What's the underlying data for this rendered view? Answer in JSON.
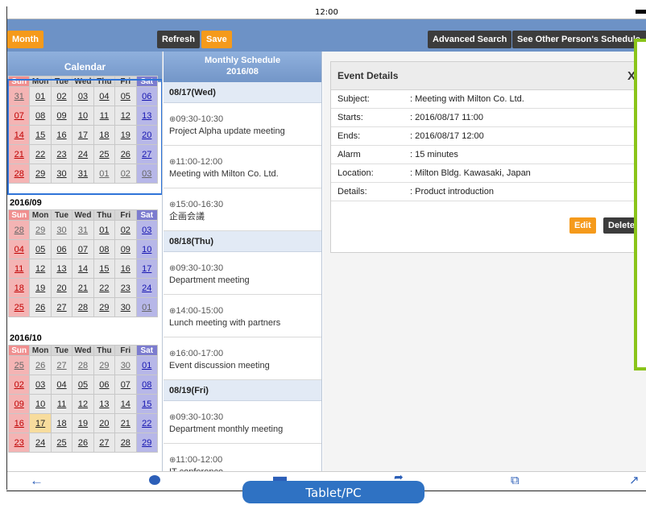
{
  "status_bar": {
    "time": "12:00"
  },
  "toolbar": {
    "month_label": "Month",
    "refresh_label": "Refresh",
    "save_label": "Save",
    "advanced_search_label": "Advanced Search",
    "see_other_label": "See Other Person's Schedule"
  },
  "calendar": {
    "header": "Calendar",
    "dow": [
      "Sun",
      "Mon",
      "Tue",
      "Wed",
      "Thu",
      "Fri",
      "Sat"
    ],
    "months": [
      {
        "title": "",
        "weeks": [
          [
            "31",
            "01",
            "02",
            "03",
            "04",
            "05",
            "06"
          ],
          [
            "07",
            "08",
            "09",
            "10",
            "11",
            "12",
            "13"
          ],
          [
            "14",
            "15",
            "16",
            "17",
            "18",
            "19",
            "20"
          ],
          [
            "21",
            "22",
            "23",
            "24",
            "25",
            "26",
            "27"
          ],
          [
            "28",
            "29",
            "30",
            "31",
            "01",
            "02",
            "03"
          ]
        ]
      },
      {
        "title": "2016/09",
        "weeks": [
          [
            "28",
            "29",
            "30",
            "31",
            "01",
            "02",
            "03"
          ],
          [
            "04",
            "05",
            "06",
            "07",
            "08",
            "09",
            "10"
          ],
          [
            "11",
            "12",
            "13",
            "14",
            "15",
            "16",
            "17"
          ],
          [
            "18",
            "19",
            "20",
            "21",
            "22",
            "23",
            "24"
          ],
          [
            "25",
            "26",
            "27",
            "28",
            "29",
            "30",
            "01"
          ]
        ]
      },
      {
        "title": "2016/10",
        "weeks": [
          [
            "25",
            "26",
            "27",
            "28",
            "29",
            "30",
            "01"
          ],
          [
            "02",
            "03",
            "04",
            "05",
            "06",
            "07",
            "08"
          ],
          [
            "09",
            "10",
            "11",
            "12",
            "13",
            "14",
            "15"
          ],
          [
            "16",
            "17",
            "18",
            "19",
            "20",
            "21",
            "22"
          ],
          [
            "23",
            "24",
            "25",
            "26",
            "27",
            "28",
            "29"
          ]
        ]
      }
    ]
  },
  "schedule": {
    "header_line1": "Monthly Schedule",
    "header_line2": "2016/08",
    "days": [
      {
        "label": "08/17(Wed)",
        "events": [
          {
            "time": "09:30-10:30",
            "title": "Project Alpha update meeting"
          },
          {
            "time": "11:00-12:00",
            "title": "Meeting with Milton Co. Ltd."
          },
          {
            "time": "15:00-16:30",
            "title": "企画会議"
          }
        ]
      },
      {
        "label": "08/18(Thu)",
        "events": [
          {
            "time": "09:30-10:30",
            "title": "Department meeting"
          },
          {
            "time": "14:00-15:00",
            "title": "Lunch meeting with partners"
          },
          {
            "time": "16:00-17:00",
            "title": "Event discussion meeting"
          }
        ]
      },
      {
        "label": "08/19(Fri)",
        "events": [
          {
            "time": "09:30-10:30",
            "title": "Department monthly meeting"
          },
          {
            "time": "11:00-12:00",
            "title": "IT conference"
          }
        ]
      }
    ]
  },
  "event_details": {
    "title": "Event Details",
    "close_glyph": "X",
    "fields": [
      {
        "key": "Subject:",
        "value": ": Meeting with Milton Co. Ltd."
      },
      {
        "key": "Starts:",
        "value": ": 2016/08/17 11:00"
      },
      {
        "key": "Ends:",
        "value": ": 2016/08/17 12:00"
      },
      {
        "key": "Alarm",
        "value": ": 15 minutes"
      },
      {
        "key": "Location:",
        "value": ": Milton Bldg. Kawasaki, Japan"
      },
      {
        "key": "Details:",
        "value": ": Product introduction"
      }
    ],
    "edit_label": "Edit",
    "delete_label": "Delete"
  },
  "bottom_nav": {
    "icons": [
      "back-arrow-icon",
      "chat-bubble-icon",
      "minus-icon",
      "share-icon",
      "tabs-icon",
      "expand-icon"
    ]
  },
  "device_tag": "Tablet/PC",
  "colors": {
    "toolbar": "#6d92c6",
    "orange": "#f59a1b",
    "dark": "#3c3c3c",
    "selection": "#2f74d8",
    "overlay": "#8ac41a"
  }
}
